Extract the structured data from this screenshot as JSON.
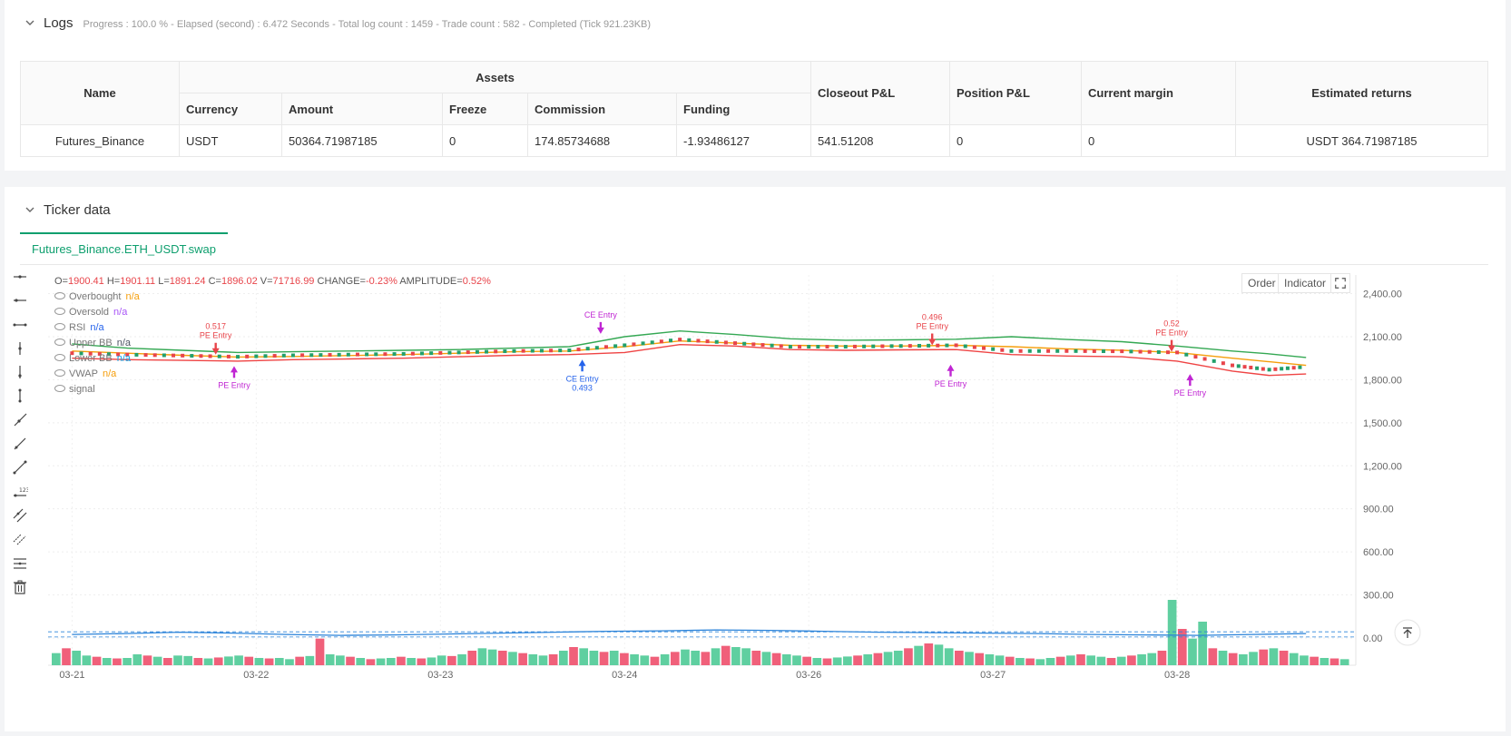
{
  "logs": {
    "title": "Logs",
    "status": "Progress : 100.0 % - Elapsed (second) : 6.472  Seconds - Total log count : 1459 - Trade count : 582 - Completed (Tick 921.23KB)",
    "table": {
      "group_header": "Assets",
      "headers": {
        "name": "Name",
        "currency": "Currency",
        "amount": "Amount",
        "freeze": "Freeze",
        "commission": "Commission",
        "funding": "Funding",
        "closeout": "Closeout P&L",
        "position": "Position P&L",
        "margin": "Current margin",
        "returns": "Estimated returns"
      },
      "row": {
        "name": "Futures_Binance",
        "currency": "USDT",
        "amount": "50364.71987185",
        "freeze": "0",
        "commission": "174.85734688",
        "funding": "-1.93486127",
        "closeout": "541.51208",
        "position": "0",
        "margin": "0",
        "returns": "USDT 364.71987185"
      }
    }
  },
  "ticker": {
    "title": "Ticker data",
    "tab": "Futures_Binance.ETH_USDT.swap",
    "ohlc": {
      "o_label": "O=",
      "o": "1900.41",
      "h_label": "H=",
      "h": "1901.11",
      "l_label": "L=",
      "l": "1891.24",
      "c_label": "C=",
      "c": "1896.02",
      "v_label": "V=",
      "v": "71716.99",
      "change_label": "CHANGE=",
      "change": "-0.23%",
      "amp_label": "AMPLITUDE=",
      "amp": "0.52%"
    },
    "legend": [
      {
        "name": "Overbought",
        "value": "n/a",
        "color": "#f59e0b"
      },
      {
        "name": "Oversold",
        "value": "n/a",
        "color": "#a855f7"
      },
      {
        "name": "RSI",
        "value": "n/a",
        "color": "#2563eb"
      },
      {
        "name": "Upper BB",
        "value": "n/a",
        "color": "#4b5563"
      },
      {
        "name": "Lower BB",
        "value": "n/a",
        "color": "#0ea5e9"
      },
      {
        "name": "VWAP",
        "value": "n/a",
        "color": "#f59e0b"
      },
      {
        "name": "signal",
        "value": "",
        "color": "#777"
      }
    ],
    "buttons": {
      "order": "Order",
      "indicator": "Indicator"
    }
  },
  "chart_data": {
    "type": "candlestick",
    "y_ticks": [
      "2,400.00",
      "2,100.00",
      "1,800.00",
      "1,500.00",
      "1,200.00",
      "900.00",
      "600.00",
      "300.00",
      "0.00"
    ],
    "y_values": [
      2400,
      2100,
      1800,
      1500,
      1200,
      900,
      600,
      300,
      0
    ],
    "x_ticks": [
      "03-21",
      "03-22",
      "03-23",
      "03-24",
      "03-26",
      "03-27",
      "03-28"
    ],
    "x_positions": [
      0.0,
      1.0,
      2.0,
      3.0,
      4.0,
      5.0,
      6.0
    ],
    "x_range": [
      -0.13,
      6.97
    ],
    "y_range": [
      -190,
      2530
    ],
    "colors": {
      "up": "#5fcfa0",
      "down": "#f0607a",
      "upper_bb": "#34a853",
      "lower_bb": "#ef4444",
      "vwap": "#f59e0b",
      "rsi": "#2b83d9"
    },
    "price_series_x": [
      0.0,
      0.3,
      0.6,
      0.9,
      1.2,
      1.5,
      1.8,
      2.1,
      2.4,
      2.7,
      3.0,
      3.3,
      3.6,
      3.9,
      4.2,
      4.5,
      4.8,
      5.1,
      5.4,
      5.7,
      6.0,
      6.3,
      6.5,
      6.7
    ],
    "price": [
      1985,
      1975,
      1968,
      1960,
      1970,
      1975,
      1980,
      1990,
      2000,
      2005,
      2040,
      2080,
      2055,
      2030,
      2030,
      2035,
      2040,
      2000,
      2000,
      1998,
      1990,
      1900,
      1870,
      1890
    ],
    "upper_bb": [
      2050,
      2020,
      2005,
      1990,
      1995,
      2000,
      2005,
      2010,
      2020,
      2030,
      2100,
      2140,
      2115,
      2085,
      2075,
      2078,
      2082,
      2100,
      2080,
      2065,
      2035,
      2000,
      1980,
      1955
    ],
    "lower_bb": [
      1950,
      1940,
      1935,
      1930,
      1940,
      1945,
      1950,
      1960,
      1970,
      1975,
      1990,
      2045,
      2035,
      2010,
      2005,
      2008,
      2010,
      1975,
      1965,
      1960,
      1930,
      1860,
      1830,
      1840
    ],
    "vwap": [
      2000,
      1985,
      1970,
      1958,
      1962,
      1968,
      1975,
      1985,
      1995,
      2000,
      2030,
      2070,
      2055,
      2040,
      2035,
      2035,
      2040,
      2030,
      2015,
      2005,
      1990,
      1950,
      1925,
      1900
    ],
    "volume": [
      50,
      70,
      60,
      40,
      35,
      30,
      28,
      30,
      45,
      40,
      35,
      30,
      40,
      38,
      30,
      28,
      32,
      36,
      40,
      35,
      30,
      28,
      30,
      25,
      35,
      38,
      110,
      45,
      40,
      35,
      30,
      25,
      28,
      30,
      35,
      30,
      28,
      32,
      40,
      38,
      45,
      60,
      70,
      65,
      60,
      55,
      50,
      45,
      40,
      45,
      60,
      75,
      70,
      60,
      55,
      60,
      50,
      45,
      40,
      35,
      45,
      55,
      65,
      60,
      55,
      70,
      80,
      75,
      70,
      60,
      55,
      50,
      45,
      40,
      35,
      30,
      28,
      32,
      36,
      40,
      45,
      50,
      55,
      60,
      70,
      80,
      90,
      85,
      70,
      60,
      55,
      50,
      45,
      40,
      35,
      30,
      28,
      25,
      30,
      35,
      40,
      45,
      40,
      35,
      30,
      35,
      40,
      45,
      50,
      60,
      270,
      150,
      110,
      180,
      70,
      60,
      50,
      45,
      55,
      65,
      70,
      60,
      50,
      40,
      35,
      30,
      28,
      25
    ],
    "rsi": [
      50,
      52,
      55,
      53,
      50,
      48,
      49,
      51,
      53,
      55,
      57,
      58,
      60,
      59,
      57,
      55,
      54,
      53,
      52,
      50,
      49,
      48,
      50,
      52
    ],
    "rsi_levels": [
      70,
      30
    ],
    "signals": [
      {
        "x": 0.78,
        "y": 1975,
        "dir": "down",
        "label": "PE Entry",
        "value": "0.517",
        "color": "#e8444a"
      },
      {
        "x": 0.88,
        "y": 1895,
        "dir": "up",
        "label": "PE Entry",
        "value": "",
        "color": "#c026d3"
      },
      {
        "x": 2.87,
        "y": 2120,
        "dir": "down",
        "label": "CE Entry",
        "value": "",
        "color": "#c026d3"
      },
      {
        "x": 2.77,
        "y": 1940,
        "dir": "up",
        "label": "CE Entry",
        "value": "0.493",
        "color": "#2563eb"
      },
      {
        "x": 4.67,
        "y": 2040,
        "dir": "down",
        "label": "PE Entry",
        "value": "0.496",
        "color": "#e8444a"
      },
      {
        "x": 4.77,
        "y": 1905,
        "dir": "up",
        "label": "PE Entry",
        "value": "",
        "color": "#c026d3"
      },
      {
        "x": 5.97,
        "y": 1995,
        "dir": "down",
        "label": "PE Entry",
        "value": "0.52",
        "color": "#e8444a"
      },
      {
        "x": 6.07,
        "y": 1840,
        "dir": "up",
        "label": "PE Entry",
        "value": "",
        "color": "#c026d3"
      }
    ]
  }
}
